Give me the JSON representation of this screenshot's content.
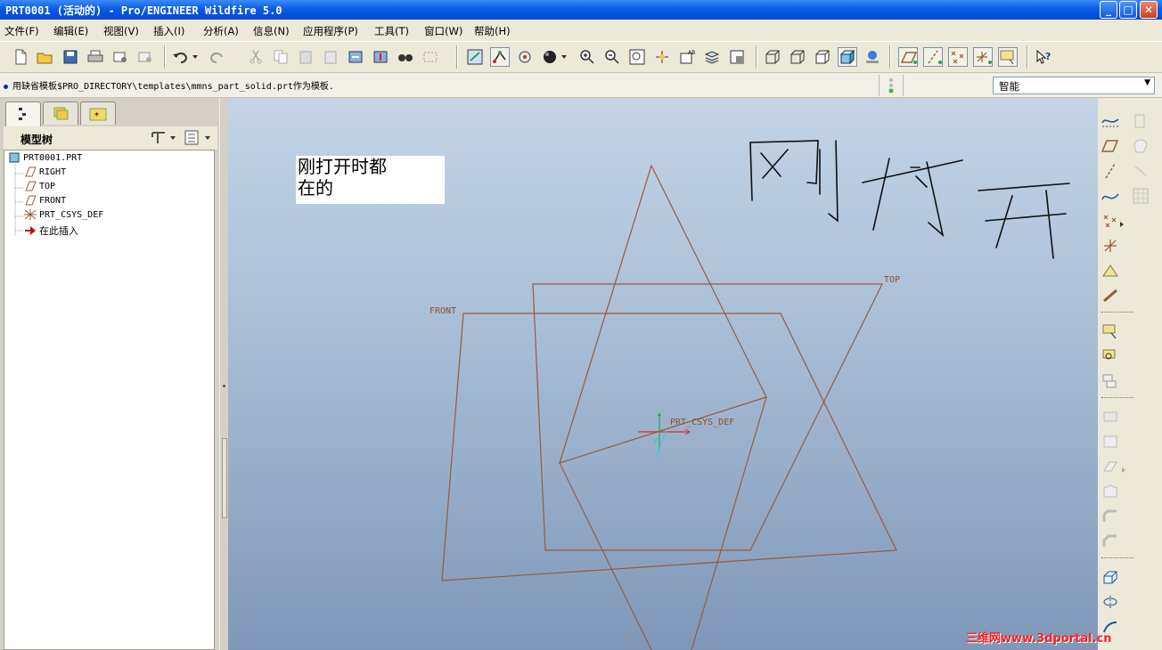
{
  "window": {
    "title": "PRT0001 (活动的) - Pro/ENGINEER Wildfire 5.0"
  },
  "menu": [
    "文件(F)",
    "编辑(E)",
    "视图(V)",
    "插入(I)",
    "分析(A)",
    "信息(N)",
    "应用程序(P)",
    "工具(T)",
    "窗口(W)",
    "帮助(H)"
  ],
  "message": "用缺省模板$PRO_DIRECTORY\\templates\\mmns_part_solid.prt作为模板.",
  "filter": {
    "selected": "智能"
  },
  "model_tree": {
    "title": "模型树",
    "root": "PRT0001.PRT",
    "items": [
      "RIGHT",
      "TOP",
      "FRONT",
      "PRT_CSYS_DEF",
      "在此插入"
    ]
  },
  "graphics": {
    "note": [
      "刚打开时都",
      "在的"
    ],
    "labels": {
      "top": "TOP",
      "front": "FRONT",
      "csys": "PRT_CSYS_DEF"
    },
    "handwriting": "刚打开"
  },
  "watermark": "三维网www.3dportal.cn",
  "colors": {
    "datum": "#9a5a3a",
    "title_bar": "#0a5be8",
    "panel": "#ece9d8"
  }
}
